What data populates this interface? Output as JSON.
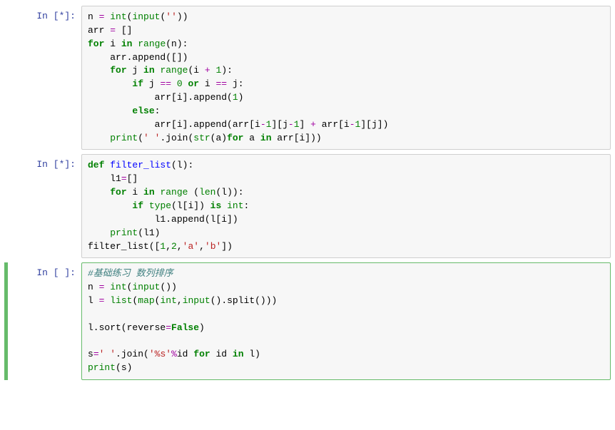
{
  "cells": [
    {
      "prompt_label": "In  ",
      "status": "[*]:",
      "selected": false,
      "tokens": [
        [
          "",
          "n "
        ],
        [
          "op",
          "="
        ],
        [
          "",
          " "
        ],
        [
          "bi",
          "int"
        ],
        [
          "",
          "("
        ],
        [
          "bi",
          "input"
        ],
        [
          "",
          "("
        ],
        [
          "str",
          "''"
        ],
        [
          "",
          ")"
        ],
        [
          "",
          ")"
        ],
        [
          "",
          "\n"
        ],
        [
          "",
          "arr "
        ],
        [
          "op",
          "="
        ],
        [
          "",
          " []\n"
        ],
        [
          "kw",
          "for"
        ],
        [
          "",
          " i "
        ],
        [
          "kw",
          "in"
        ],
        [
          "",
          " "
        ],
        [
          "bi",
          "range"
        ],
        [
          "",
          "(n):\n"
        ],
        [
          "",
          "    arr.append([])\n"
        ],
        [
          "",
          "    "
        ],
        [
          "kw",
          "for"
        ],
        [
          "",
          " j "
        ],
        [
          "kw",
          "in"
        ],
        [
          "",
          " "
        ],
        [
          "bi",
          "range"
        ],
        [
          "",
          "(i "
        ],
        [
          "op",
          "+"
        ],
        [
          "",
          " "
        ],
        [
          "num",
          "1"
        ],
        [
          "",
          "):\n"
        ],
        [
          "",
          "        "
        ],
        [
          "kw",
          "if"
        ],
        [
          "",
          " j "
        ],
        [
          "op",
          "=="
        ],
        [
          "",
          " "
        ],
        [
          "num",
          "0"
        ],
        [
          "",
          " "
        ],
        [
          "kw",
          "or"
        ],
        [
          "",
          " i "
        ],
        [
          "op",
          "=="
        ],
        [
          "",
          " j:\n"
        ],
        [
          "",
          "            arr[i].append("
        ],
        [
          "num",
          "1"
        ],
        [
          "",
          ")\n"
        ],
        [
          "",
          "        "
        ],
        [
          "kw",
          "else"
        ],
        [
          "",
          ":\n"
        ],
        [
          "",
          "            arr[i].append(arr[i"
        ],
        [
          "op",
          "-"
        ],
        [
          "num",
          "1"
        ],
        [
          "",
          "][j"
        ],
        [
          "op",
          "-"
        ],
        [
          "num",
          "1"
        ],
        [
          "",
          "] "
        ],
        [
          "op",
          "+"
        ],
        [
          "",
          " arr[i"
        ],
        [
          "op",
          "-"
        ],
        [
          "num",
          "1"
        ],
        [
          "",
          "][j])\n"
        ],
        [
          "",
          "    "
        ],
        [
          "bi",
          "print"
        ],
        [
          "",
          "("
        ],
        [
          "str",
          "' '"
        ],
        [
          "",
          ".join("
        ],
        [
          "bi",
          "str"
        ],
        [
          "",
          "(a)"
        ],
        [
          "kw",
          "for"
        ],
        [
          "",
          " a "
        ],
        [
          "kw",
          "in"
        ],
        [
          "",
          " arr[i]))"
        ]
      ]
    },
    {
      "prompt_label": "In  ",
      "status": "[*]:",
      "selected": false,
      "tokens": [
        [
          "kw",
          "def"
        ],
        [
          "",
          " "
        ],
        [
          "def",
          "filter_list"
        ],
        [
          "",
          "(l):\n"
        ],
        [
          "",
          "    l1"
        ],
        [
          "op",
          "="
        ],
        [
          "",
          "[]\n"
        ],
        [
          "",
          "    "
        ],
        [
          "kw",
          "for"
        ],
        [
          "",
          " i "
        ],
        [
          "kw",
          "in"
        ],
        [
          "",
          " "
        ],
        [
          "bi",
          "range"
        ],
        [
          "",
          " ("
        ],
        [
          "bi",
          "len"
        ],
        [
          "",
          "(l)):\n"
        ],
        [
          "",
          "        "
        ],
        [
          "kw",
          "if"
        ],
        [
          "",
          " "
        ],
        [
          "bi",
          "type"
        ],
        [
          "",
          "(l[i]) "
        ],
        [
          "kw",
          "is"
        ],
        [
          "",
          " "
        ],
        [
          "bi",
          "int"
        ],
        [
          "",
          ":\n"
        ],
        [
          "",
          "            l1.append(l[i])\n"
        ],
        [
          "",
          "    "
        ],
        [
          "bi",
          "print"
        ],
        [
          "",
          "(l1)\n"
        ],
        [
          "",
          "filter_list(["
        ],
        [
          "num",
          "1"
        ],
        [
          "",
          ","
        ],
        [
          "num",
          "2"
        ],
        [
          "",
          ","
        ],
        [
          "str",
          "'a'"
        ],
        [
          "",
          ","
        ],
        [
          "str",
          "'b'"
        ],
        [
          "",
          "])"
        ]
      ]
    },
    {
      "prompt_label": "In  ",
      "status": "[ ]:",
      "selected": true,
      "tokens": [
        [
          "cm",
          "#基础练习 数列排序"
        ],
        [
          "",
          "\n"
        ],
        [
          "",
          "n "
        ],
        [
          "op",
          "="
        ],
        [
          "",
          " "
        ],
        [
          "bi",
          "int"
        ],
        [
          "",
          "("
        ],
        [
          "bi",
          "input"
        ],
        [
          "",
          "())\n"
        ],
        [
          "",
          "l "
        ],
        [
          "op",
          "="
        ],
        [
          "",
          " "
        ],
        [
          "bi",
          "list"
        ],
        [
          "",
          "("
        ],
        [
          "bi",
          "map"
        ],
        [
          "",
          "("
        ],
        [
          "bi",
          "int"
        ],
        [
          "",
          ","
        ],
        [
          "bi",
          "input"
        ],
        [
          "",
          "().split()))\n"
        ],
        [
          "",
          "\n"
        ],
        [
          "",
          "l.sort(reverse"
        ],
        [
          "op",
          "="
        ],
        [
          "kw",
          "False"
        ],
        [
          "",
          ")\n"
        ],
        [
          "",
          "\n"
        ],
        [
          "",
          "s"
        ],
        [
          "op",
          "="
        ],
        [
          "str",
          "' '"
        ],
        [
          "",
          ".join("
        ],
        [
          "str",
          "'%s'"
        ],
        [
          "op",
          "%"
        ],
        [
          "",
          "id "
        ],
        [
          "kw",
          "for"
        ],
        [
          "",
          " id "
        ],
        [
          "kw",
          "in"
        ],
        [
          "",
          " l)\n"
        ],
        [
          "bi",
          "print"
        ],
        [
          "",
          "(s)"
        ]
      ]
    }
  ]
}
